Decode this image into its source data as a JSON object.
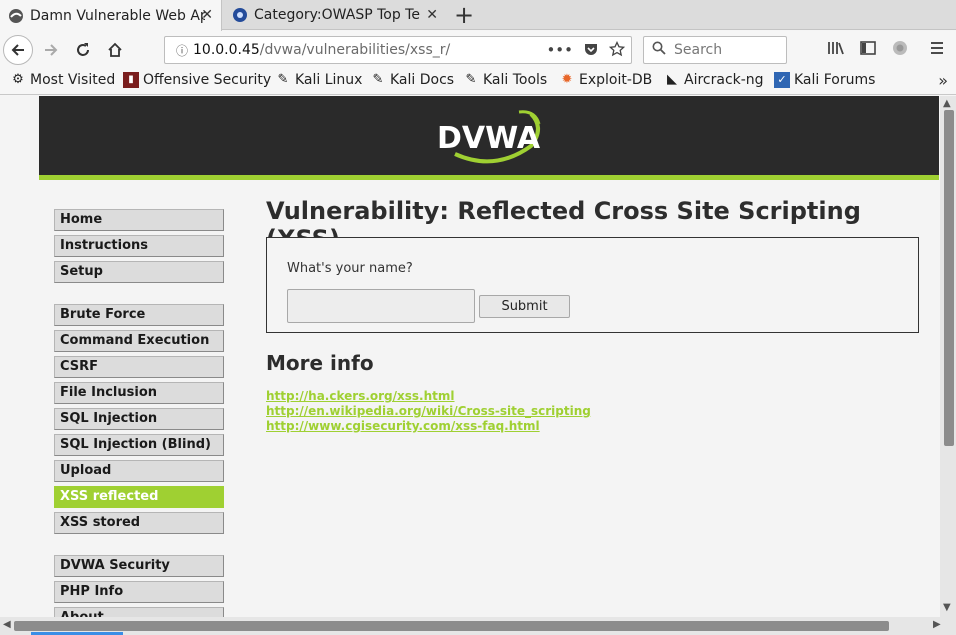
{
  "browser": {
    "tabs": [
      {
        "title": "Damn Vulnerable Web Ap",
        "active": true
      },
      {
        "title": "Category:OWASP Top Te",
        "active": false
      }
    ],
    "new_tab": "+",
    "close_glyph": "✕",
    "url": {
      "host": "10.0.0.45",
      "path": "/dvwa/vulnerabilities/xss_r/"
    },
    "search_placeholder": "Search",
    "bookmarks": [
      {
        "label": "Most Visited",
        "icon": "gear-icon"
      },
      {
        "label": "Offensive Security",
        "icon": "offsec-icon"
      },
      {
        "label": "Kali Linux",
        "icon": "kali-dragon-icon"
      },
      {
        "label": "Kali Docs",
        "icon": "kali-dragon-icon"
      },
      {
        "label": "Kali Tools",
        "icon": "kali-dragon-icon"
      },
      {
        "label": "Exploit-DB",
        "icon": "exploitdb-icon"
      },
      {
        "label": "Aircrack-ng",
        "icon": "aircrack-icon"
      },
      {
        "label": "Kali Forums",
        "icon": "kali-forums-icon"
      }
    ]
  },
  "dvwa": {
    "logo_text": "DVWA",
    "menu_group1": [
      "Home",
      "Instructions",
      "Setup"
    ],
    "menu_group2": [
      "Brute Force",
      "Command Execution",
      "CSRF",
      "File Inclusion",
      "SQL Injection",
      "SQL Injection (Blind)",
      "Upload",
      "XSS reflected",
      "XSS stored"
    ],
    "menu_group3": [
      "DVWA Security",
      "PHP Info",
      "About"
    ],
    "selected_item": "XSS reflected",
    "page_title": "Vulnerability: Reflected Cross Site Scripting (XSS)",
    "form": {
      "question": "What's your name?",
      "input_value": "",
      "submit_label": "Submit"
    },
    "more_info_title": "More info",
    "links": [
      "http://ha.ckers.org/xss.html",
      "http://en.wikipedia.org/wiki/Cross-site_scripting",
      "http://www.cgisecurity.com/xss-faq.html"
    ]
  },
  "colors": {
    "accent": "#9fd032",
    "header_bg": "#2a2a2a"
  }
}
